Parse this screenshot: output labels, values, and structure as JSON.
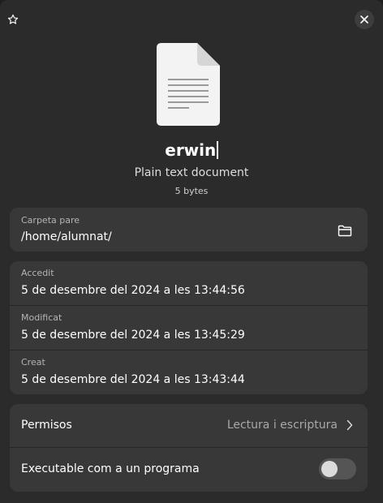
{
  "header": {
    "star_icon": "star-outline-icon",
    "close_icon": "close-icon"
  },
  "file": {
    "icon": "text-document-icon",
    "name": "erwin",
    "type": "Plain text document",
    "size": "5 bytes"
  },
  "location": {
    "label": "Carpeta pare",
    "path": "/home/alumnat/",
    "open_folder_icon": "folder-open-icon"
  },
  "times": [
    {
      "label": "Accedit",
      "value": "5 de desembre del 2024 a les 13:44:56"
    },
    {
      "label": "Modificat",
      "value": "5 de desembre del 2024 a les 13:45:29"
    },
    {
      "label": "Creat",
      "value": "5 de desembre del 2024 a les 13:43:44"
    }
  ],
  "permissions": {
    "label": "Permisos",
    "value": "Lectura i escriptura",
    "chevron_icon": "chevron-right-icon"
  },
  "executable": {
    "label": "Executable com a un programa",
    "enabled": false
  },
  "colors": {
    "window_bg": "#2b2b2b",
    "card_bg": "#383838",
    "toggle_off": "#555555"
  }
}
